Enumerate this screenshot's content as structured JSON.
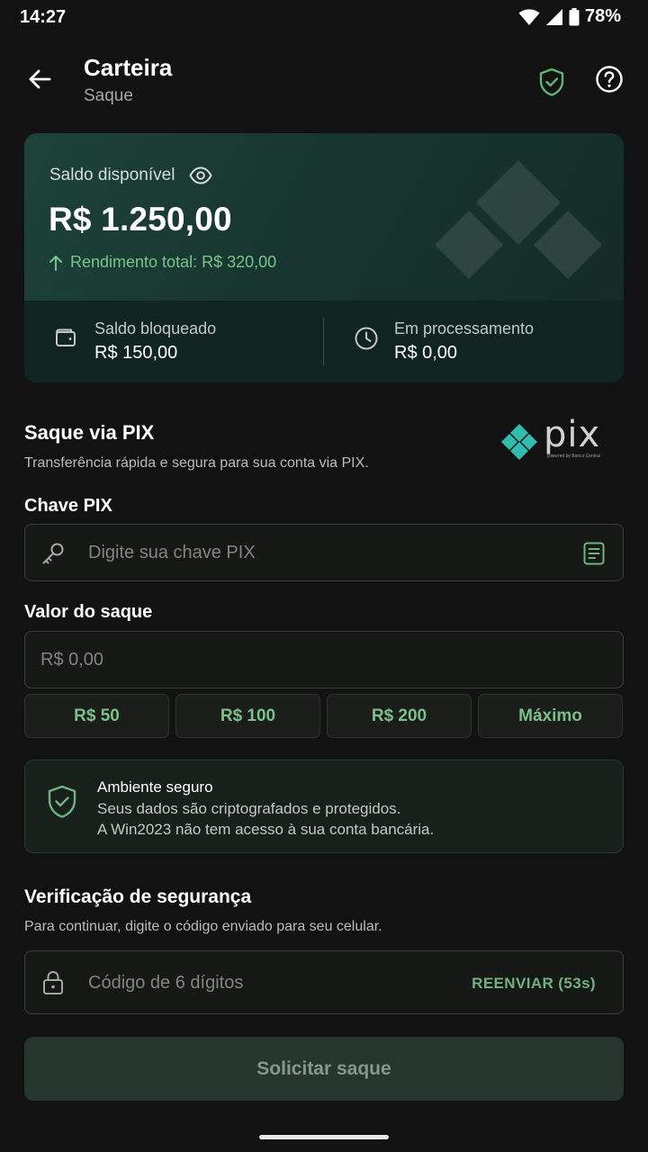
{
  "status_bar": {
    "time": "14:27",
    "battery": "78%"
  },
  "header": {
    "title": "Carteira",
    "subtitle": "Saque"
  },
  "balance": {
    "label": "Saldo disponível",
    "amount": "R$ 1.250,00",
    "yield": "Rendimento total: R$ 320,00",
    "blocked_label": "Saldo bloqueado",
    "blocked_value": "R$ 150,00",
    "processing_label": "Em processamento",
    "processing_value": "R$ 0,00"
  },
  "pix": {
    "title": "Saque via PIX",
    "description": "Transferência rápida e segura para sua conta via PIX.",
    "logo_text": "pix",
    "logo_caption": "powered by Banco Central"
  },
  "pix_key": {
    "label": "Chave PIX",
    "placeholder": "Digite sua chave PIX"
  },
  "amount": {
    "label": "Valor do saque",
    "placeholder": "R$ 0,00",
    "quick": [
      "R$ 50",
      "R$ 100",
      "R$ 200",
      "Máximo"
    ]
  },
  "secure": {
    "title": "Ambiente seguro",
    "line1": "Seus dados são criptografados e protegidos.",
    "line2": "A Win2023 não tem acesso à sua conta bancária."
  },
  "verification": {
    "title": "Verificação de segurança",
    "description": "Para continuar, digite o código enviado para seu celular.",
    "placeholder": "Código de 6 dígitos",
    "resend": "REENVIAR (53s)"
  },
  "submit": {
    "label": "Solicitar saque"
  },
  "colors": {
    "accent": "#78c48a",
    "background": "#121212",
    "card": "#1c433a"
  }
}
